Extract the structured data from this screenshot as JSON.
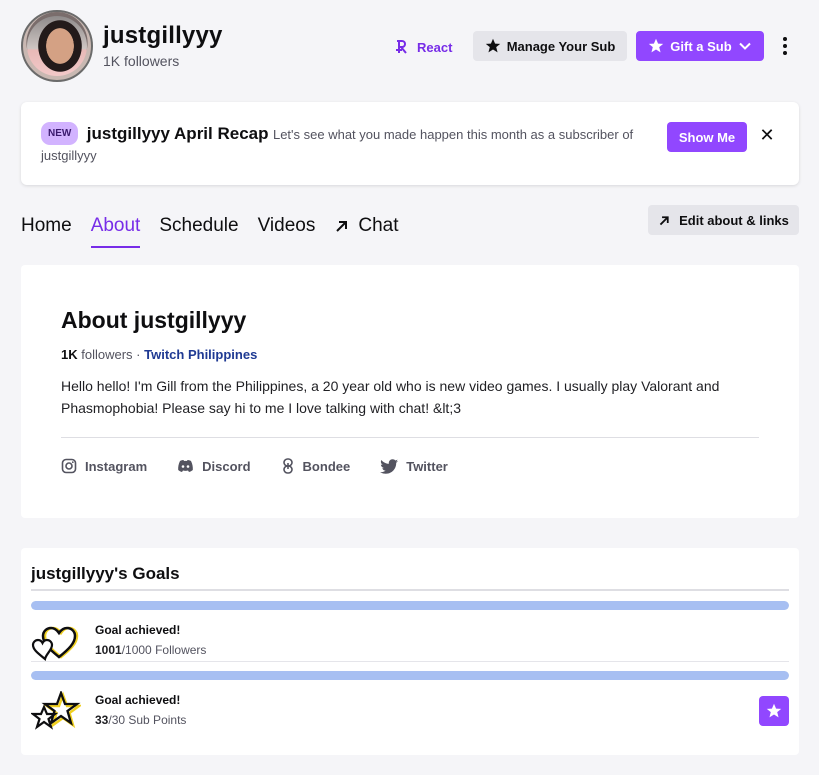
{
  "header": {
    "channel_name": "justgillyyy",
    "followers": "1K followers",
    "react_label": "React",
    "manage_sub_label": "Manage Your Sub",
    "gift_sub_label": "Gift a Sub"
  },
  "banner": {
    "badge": "NEW",
    "title": "justgillyyy April Recap",
    "description": "Let's see what you made happen this month as a subscriber of justgillyyy",
    "show_me_label": "Show Me",
    "close_label": "✕"
  },
  "tabs": [
    {
      "label": "Home",
      "active": false
    },
    {
      "label": "About",
      "active": true
    },
    {
      "label": "Schedule",
      "active": false
    },
    {
      "label": "Videos",
      "active": false
    },
    {
      "label": "Chat",
      "active": false
    }
  ],
  "edit_about_label": "Edit about & links",
  "about": {
    "title": "About justgillyyy",
    "followers_count": "1K",
    "followers_word": "followers",
    "separator": "·",
    "team": "Twitch Philippines",
    "description": "Hello hello! I'm Gill from the Philippines, a 20 year old who is new video games. I usually play Valorant and Phasmophobia! Please say hi to me I love talking with chat! &lt;3",
    "social_links": [
      "Instagram",
      "Discord",
      "Bondee",
      "Twitter"
    ]
  },
  "goals": {
    "title": "justgillyyy's Goals",
    "items": [
      {
        "status": "Goal achieved!",
        "current": "1001",
        "target": "/1000 Followers",
        "progress_percent": 100,
        "icon": "hearts-icon"
      },
      {
        "status": "Goal achieved!",
        "current": "33",
        "target": "/30 Sub Points",
        "progress_percent": 100,
        "icon": "stars-icon"
      }
    ]
  },
  "colors": {
    "accent": "#9147ff",
    "accent_text": "#772ce8",
    "goal_bar": "#a7bff2",
    "team_link": "#1f3a93"
  }
}
